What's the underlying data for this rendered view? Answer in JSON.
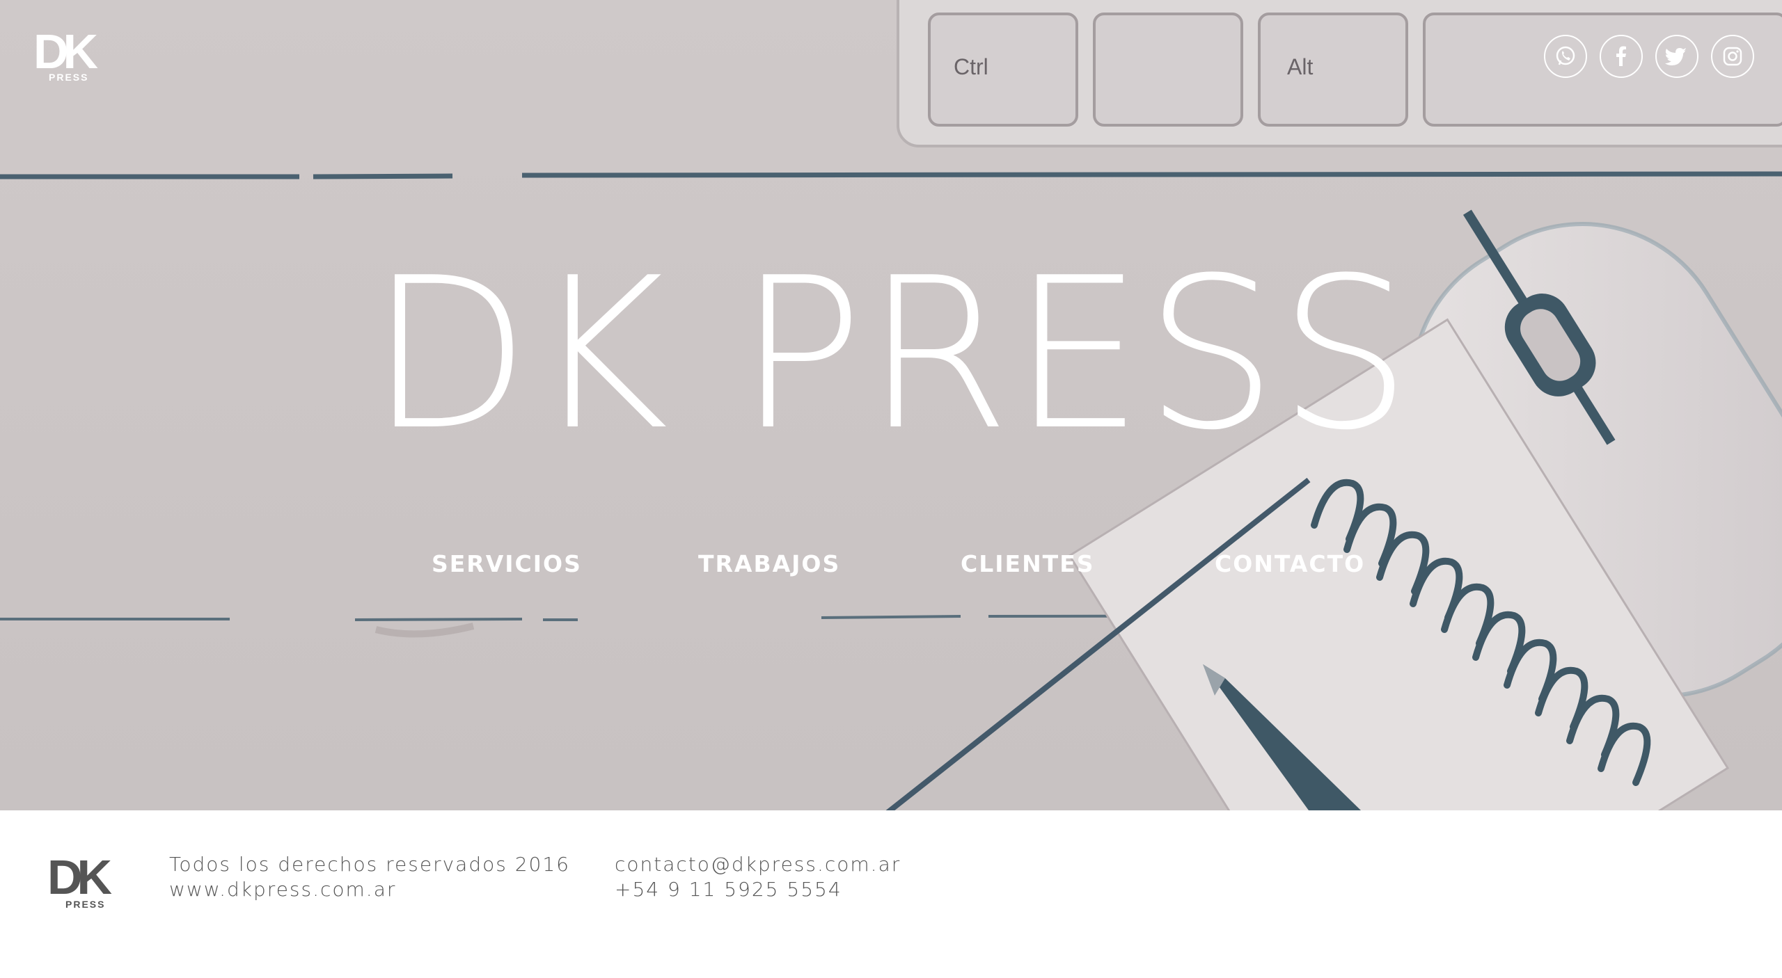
{
  "header": {
    "logo_text": "DK",
    "logo_sub": "PRESS",
    "social": [
      {
        "name": "whatsapp-icon"
      },
      {
        "name": "facebook-icon"
      },
      {
        "name": "twitter-icon"
      },
      {
        "name": "instagram-icon"
      }
    ]
  },
  "hero": {
    "title": "DK PRESS",
    "keys": [
      "Ctrl",
      "Alt"
    ]
  },
  "nav": {
    "items": [
      "SERVICIOS",
      "TRABAJOS",
      "CLIENTES",
      "CONTACTO"
    ]
  },
  "footer": {
    "logo_text": "DK",
    "logo_sub": "PRESS",
    "rights": "Todos los derechos reservados 2016",
    "website": "www.dkpress.com.ar",
    "email": "contacto@dkpress.com.ar",
    "phone": "+54 9 11 5925 5554"
  },
  "colors": {
    "hero_bg": "#ccc6c6",
    "accent_dark": "#3f5866",
    "text_white": "#ffffff",
    "footer_text": "#555555"
  }
}
